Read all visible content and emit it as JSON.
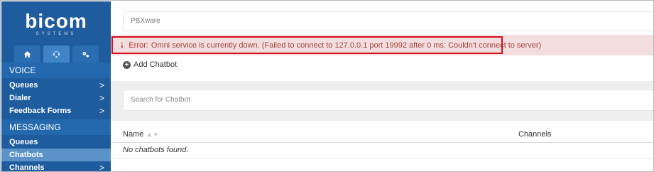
{
  "sidebar": {
    "logo_text": "bicom",
    "logo_sub": "SYSTEMS",
    "icon_tabs": [
      "home-icon",
      "support-icon",
      "settings-icon"
    ],
    "sections": [
      {
        "label": "VOICE"
      },
      {
        "label": "MESSAGING"
      }
    ],
    "voice_items": [
      {
        "label": "Queues",
        "chevron": ">"
      },
      {
        "label": "Dialer",
        "chevron": ">"
      },
      {
        "label": "Feedback Forms",
        "chevron": ">"
      }
    ],
    "messaging_items": [
      {
        "label": "Queues",
        "chevron": ""
      },
      {
        "label": "Chatbots",
        "chevron": ""
      },
      {
        "label": "Channels",
        "chevron": ">"
      }
    ],
    "active_item": "Chatbots"
  },
  "header": {
    "server_field_value": "PBXware"
  },
  "error": {
    "label": "Error:",
    "message": "Omni service is currently down. (Failed to connect to 127.0.0.1 port 19992 after 0 ms: Couldn't connect to server)"
  },
  "actions": {
    "add_chatbot": "Add Chatbot"
  },
  "search": {
    "placeholder": "Search for Chatbot"
  },
  "table": {
    "columns": [
      "Name",
      "Channels"
    ],
    "empty_text": "No chatbots found."
  },
  "colors": {
    "sidebar_bg": "#1e5c9e",
    "error_border": "#d40f1f",
    "error_bg": "#f2dede"
  }
}
